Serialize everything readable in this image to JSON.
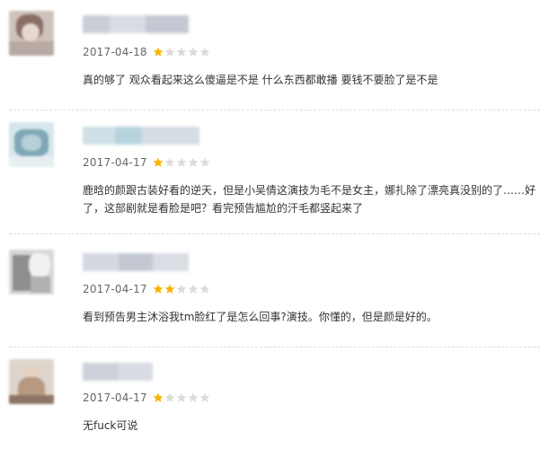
{
  "colors": {
    "star_filled": "#f7b500",
    "star_empty": "#dcdcdc",
    "divider": "#dddddd",
    "text": "#333333",
    "date": "#666666"
  },
  "reviews": [
    {
      "date": "2017-04-18",
      "rating": 1,
      "max_rating": 5,
      "comment": "真的够了 观众看起来这么傻逼是不是 什么东西都敢播 要钱不要脸了是不是"
    },
    {
      "date": "2017-04-17",
      "rating": 1,
      "max_rating": 5,
      "comment": "鹿晗的颜跟古装好看的逆天，但是小吴倩这演技为毛不是女主，娜扎除了漂亮真没别的了……好了，这部剧就是看脸是吧？看完预告尴尬的汗毛都竖起来了"
    },
    {
      "date": "2017-04-17",
      "rating": 2,
      "max_rating": 5,
      "comment": "看到预告男主沐浴我tm脸红了是怎么回事?演技。你懂的，但是颜是好的。"
    },
    {
      "date": "2017-04-17",
      "rating": 1,
      "max_rating": 5,
      "comment": "无fuck可说"
    }
  ]
}
